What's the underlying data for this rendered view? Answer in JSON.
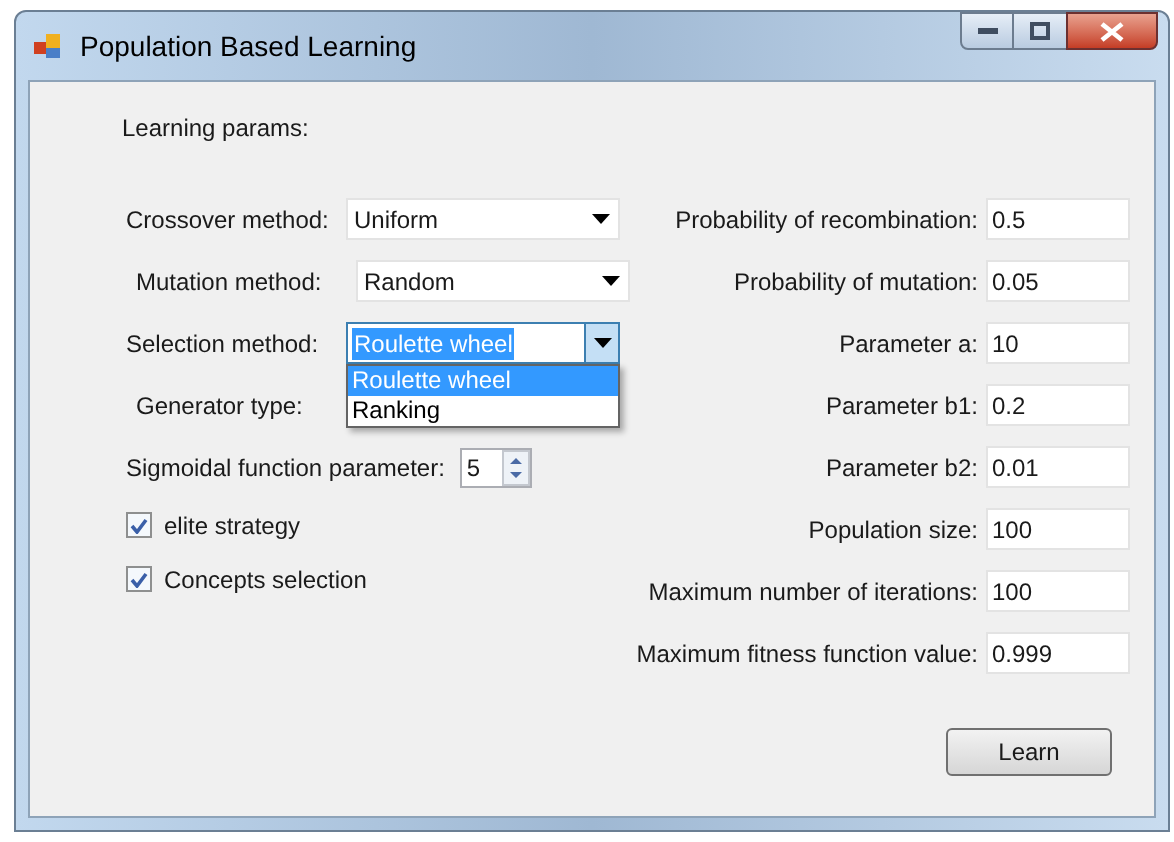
{
  "window": {
    "title": "Population Based Learning"
  },
  "section_label": "Learning params:",
  "left_fields": [
    {
      "kind": "combo",
      "label": "Crossover method:",
      "value": "Uniform",
      "open": false
    },
    {
      "kind": "combo",
      "label": "Mutation method:",
      "value": "Random",
      "open": false
    },
    {
      "kind": "combo",
      "label": "Selection method:",
      "value": "Roulette wheel",
      "open": true,
      "options": [
        {
          "label": "Roulette wheel",
          "selected": true
        },
        {
          "label": "Ranking",
          "selected": false
        }
      ]
    },
    {
      "kind": "label",
      "label": "Generator type:"
    },
    {
      "kind": "spin",
      "label": "Sigmoidal function parameter:",
      "value": "5"
    },
    {
      "kind": "checkbox",
      "label": "elite strategy",
      "checked": true
    },
    {
      "kind": "checkbox",
      "label": "Concepts selection",
      "checked": true
    }
  ],
  "right_fields": [
    {
      "label": "Probability of recombination:",
      "value": "0.5"
    },
    {
      "label": "Probability of mutation:",
      "value": "0.05"
    },
    {
      "label": "Parameter a:",
      "value": "10"
    },
    {
      "label": "Parameter b1:",
      "value": "0.2"
    },
    {
      "label": "Parameter b2:",
      "value": "0.01"
    },
    {
      "label": "Population size:",
      "value": "100"
    },
    {
      "label": "Maximum number of iterations:",
      "value": "100"
    },
    {
      "label": "Maximum fitness function value:",
      "value": "0.999"
    }
  ],
  "buttons": [
    "Learn"
  ]
}
